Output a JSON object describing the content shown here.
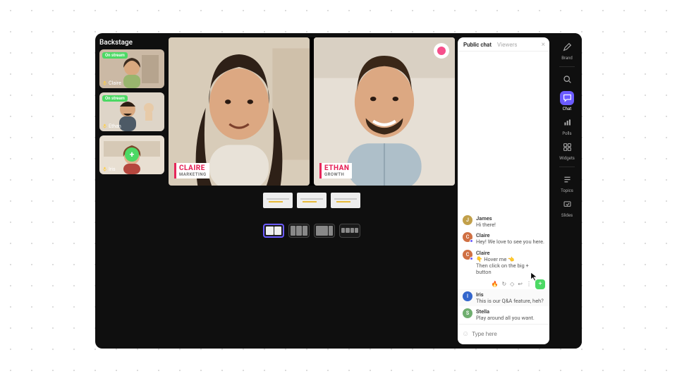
{
  "backstage": {
    "title": "Backstage",
    "on_stream_label": "On stream",
    "participants": [
      {
        "name": "Claire",
        "on_stream": true
      },
      {
        "name": "Ethan",
        "on_stream": true
      },
      {
        "name": "Iris",
        "on_stream": false,
        "has_add_button": true
      }
    ]
  },
  "stage": {
    "tiles": [
      {
        "name": "CLAIRE",
        "role": "MARKETING"
      },
      {
        "name": "ETHAN",
        "role": "GROWTH"
      }
    ],
    "slide_thumbs": 3,
    "layouts": [
      "split-2",
      "split-3",
      "pip",
      "grid"
    ],
    "active_layout": "split-2"
  },
  "chat": {
    "tabs": {
      "public": "Public chat",
      "viewers": "Viewers"
    },
    "active_tab": "public",
    "messages": [
      {
        "avatar": "J",
        "avatar_color": "#c2a04a",
        "name": "James",
        "text": "Hi there!"
      },
      {
        "avatar": "C",
        "avatar_color": "#d07043",
        "name": "Claire",
        "text": "Hey! We love to see you here.",
        "presenter": true
      },
      {
        "avatar": "C",
        "avatar_color": "#d07043",
        "name": "Claire",
        "text": "👇 Hover me 👈\nThen click on the big + button",
        "presenter": true
      },
      {
        "avatar": "I",
        "avatar_color": "#3366cc",
        "name": "Iris",
        "text": "This is our Q&A feature, heh?",
        "highlighted": true
      },
      {
        "avatar": "S",
        "avatar_color": "#6fae6f",
        "name": "Stella",
        "text": "Play around all you want."
      }
    ],
    "reaction_icons": [
      "🔥",
      "↻",
      "◇",
      "↩",
      "⋮"
    ],
    "input_placeholder": "Type here"
  },
  "rail": {
    "items": [
      {
        "key": "brand",
        "label": "Brand",
        "icon": "pen"
      },
      {
        "key": "search",
        "label": "",
        "icon": "search"
      },
      {
        "key": "chat",
        "label": "Chat",
        "icon": "chat",
        "active": true
      },
      {
        "key": "polls",
        "label": "Polls",
        "icon": "polls"
      },
      {
        "key": "widgets",
        "label": "Widgets",
        "icon": "widgets"
      },
      {
        "key": "topics",
        "label": "Topics",
        "icon": "topics"
      },
      {
        "key": "slides",
        "label": "Slides",
        "icon": "slides"
      }
    ]
  },
  "colors": {
    "accent": "#6b5bff",
    "green": "#4cd964",
    "brand_pink": "#f64f8b",
    "lt_red": "#e6265a"
  }
}
